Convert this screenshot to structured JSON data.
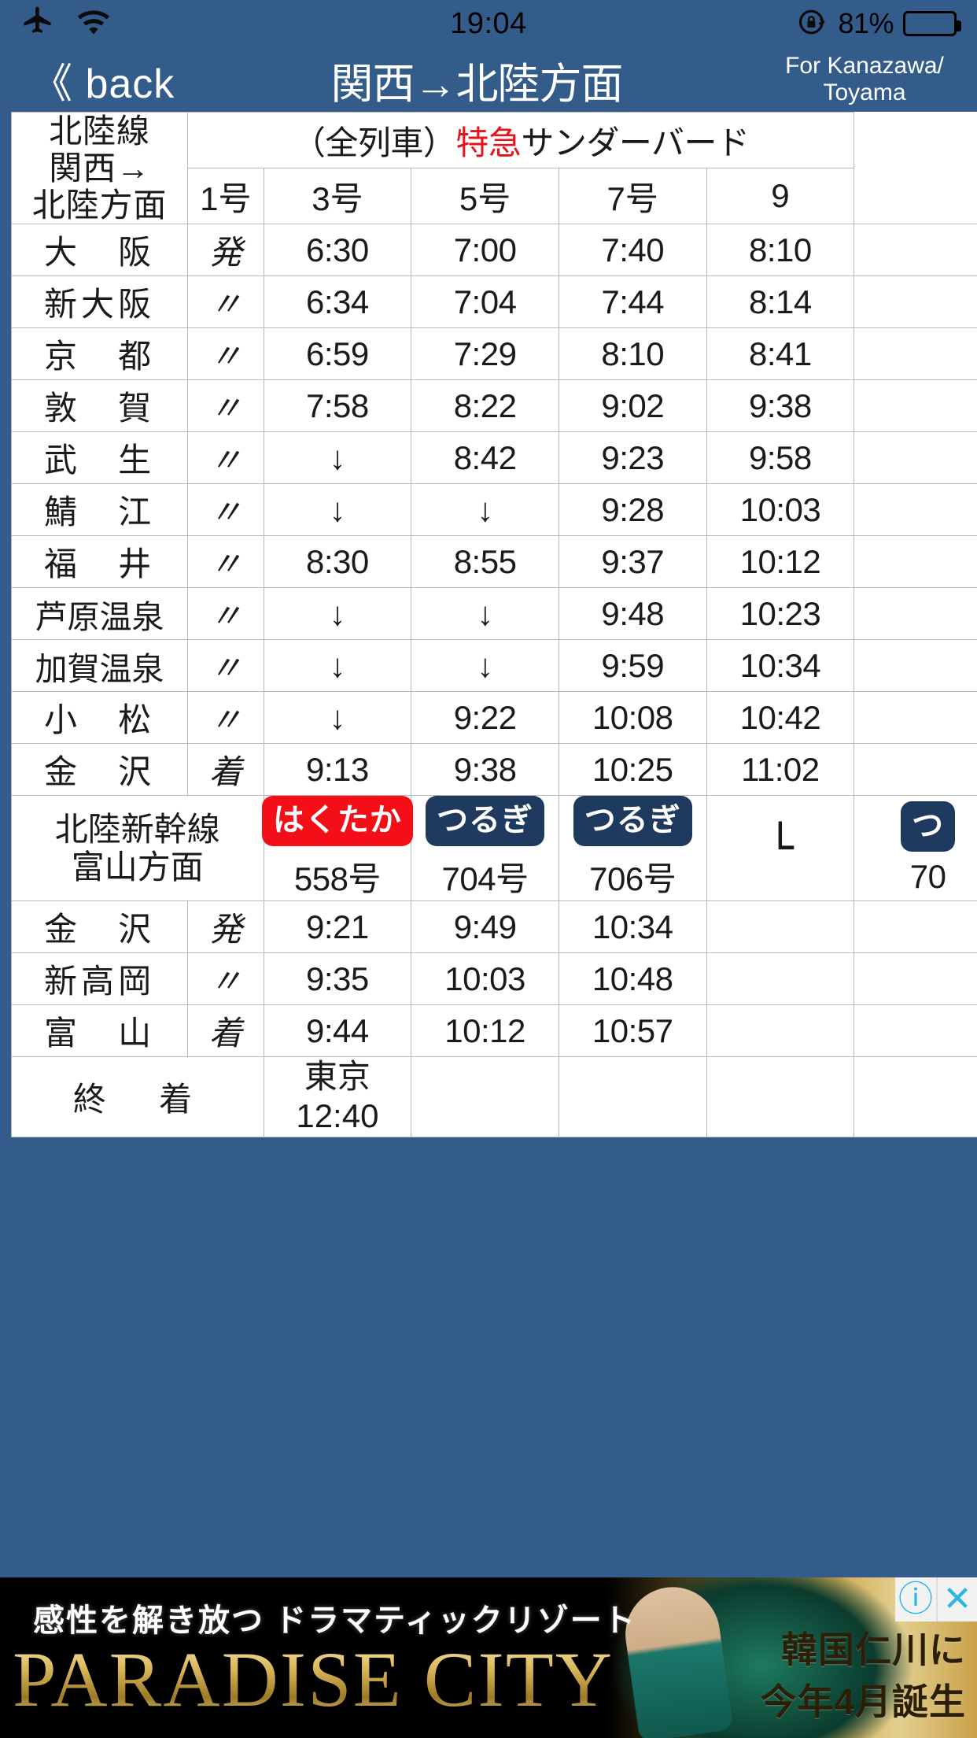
{
  "status_bar": {
    "airplane_icon": "airplane-icon",
    "wifi_icon": "wifi-icon",
    "time": "19:04",
    "rotation_lock_icon": "rotation-lock-icon",
    "battery_percent": "81%",
    "battery_level": 81
  },
  "nav": {
    "back_label": "《 back",
    "title": "関西→北陸方面",
    "subtitle_line1": "For Kanazawa/",
    "subtitle_line2": "Toyama"
  },
  "table": {
    "corner_header": "北陸線\n関西→\n北陸方面",
    "corner_header_lines": [
      "北陸線",
      "関西→",
      "北陸方面"
    ],
    "service_title_prefix": "（全列車）",
    "service_title_red": "特急",
    "service_title_suffix": "サンダーバード",
    "train_numbers": [
      "1号",
      "3号",
      "5号",
      "7号",
      "9"
    ],
    "rows": [
      {
        "station": "大　阪",
        "mark": "発",
        "times": [
          "6:30",
          "7:00",
          "7:40",
          "8:10",
          ""
        ]
      },
      {
        "station": "新大阪",
        "mark": "〃",
        "times": [
          "6:34",
          "7:04",
          "7:44",
          "8:14",
          ""
        ]
      },
      {
        "station": "京　都",
        "mark": "〃",
        "times": [
          "6:59",
          "7:29",
          "8:10",
          "8:41",
          ""
        ]
      },
      {
        "station": "敦　賀",
        "mark": "〃",
        "times": [
          "7:58",
          "8:22",
          "9:02",
          "9:38",
          ""
        ]
      },
      {
        "station": "武　生",
        "mark": "〃",
        "times": [
          "↓",
          "8:42",
          "9:23",
          "9:58",
          ""
        ]
      },
      {
        "station": "鯖　江",
        "mark": "〃",
        "times": [
          "↓",
          "↓",
          "9:28",
          "10:03",
          ""
        ]
      },
      {
        "station": "福　井",
        "mark": "〃",
        "times": [
          "8:30",
          "8:55",
          "9:37",
          "10:12",
          ""
        ]
      },
      {
        "station": "芦原温泉",
        "mark": "〃",
        "times": [
          "↓",
          "↓",
          "9:48",
          "10:23",
          ""
        ]
      },
      {
        "station": "加賀温泉",
        "mark": "〃",
        "times": [
          "↓",
          "↓",
          "9:59",
          "10:34",
          ""
        ]
      },
      {
        "station": "小　松",
        "mark": "〃",
        "times": [
          "↓",
          "9:22",
          "10:08",
          "10:42",
          ""
        ]
      },
      {
        "station": "金　沢",
        "mark": "着",
        "times": [
          "9:13",
          "9:38",
          "10:25",
          "11:02",
          ""
        ]
      }
    ],
    "shinkansen": {
      "label_lines": [
        "北陸新幹線",
        "富山方面"
      ],
      "services": [
        {
          "badge": "はくたか",
          "badge_color": "#f40f18",
          "number": "558号"
        },
        {
          "badge": "つるぎ",
          "badge_color": "#1e3a5f",
          "number": "704号"
        },
        {
          "badge": "つるぎ",
          "badge_color": "#1e3a5f",
          "number": "706号"
        },
        {
          "badge": "",
          "badge_color": "",
          "number": "",
          "connector": "└"
        },
        {
          "badge": "つ",
          "badge_color": "#1e3a5f",
          "number": "70"
        }
      ],
      "rows": [
        {
          "station": "金　沢",
          "mark": "発",
          "times": [
            "9:21",
            "9:49",
            "10:34",
            "",
            ""
          ]
        },
        {
          "station": "新高岡",
          "mark": "〃",
          "times": [
            "9:35",
            "10:03",
            "10:48",
            "",
            ""
          ]
        },
        {
          "station": "富　山",
          "mark": "着",
          "times": [
            "9:44",
            "10:12",
            "10:57",
            "",
            ""
          ]
        }
      ]
    },
    "terminus": {
      "label": "終　着",
      "cells": [
        {
          "line1": "東京",
          "line2": "12:40"
        },
        {
          "line1": "",
          "line2": ""
        },
        {
          "line1": "",
          "line2": ""
        },
        {
          "line1": "",
          "line2": ""
        },
        {
          "line1": "",
          "line2": ""
        }
      ]
    }
  },
  "ad": {
    "tagline": "感性を解き放つ ドラマティックリゾート",
    "brand": "PARADISE CITY",
    "right_line1": "韓国仁川に",
    "right_line2": "今年4月誕生",
    "info_icon": "ⓘ",
    "close_icon": "✕"
  }
}
